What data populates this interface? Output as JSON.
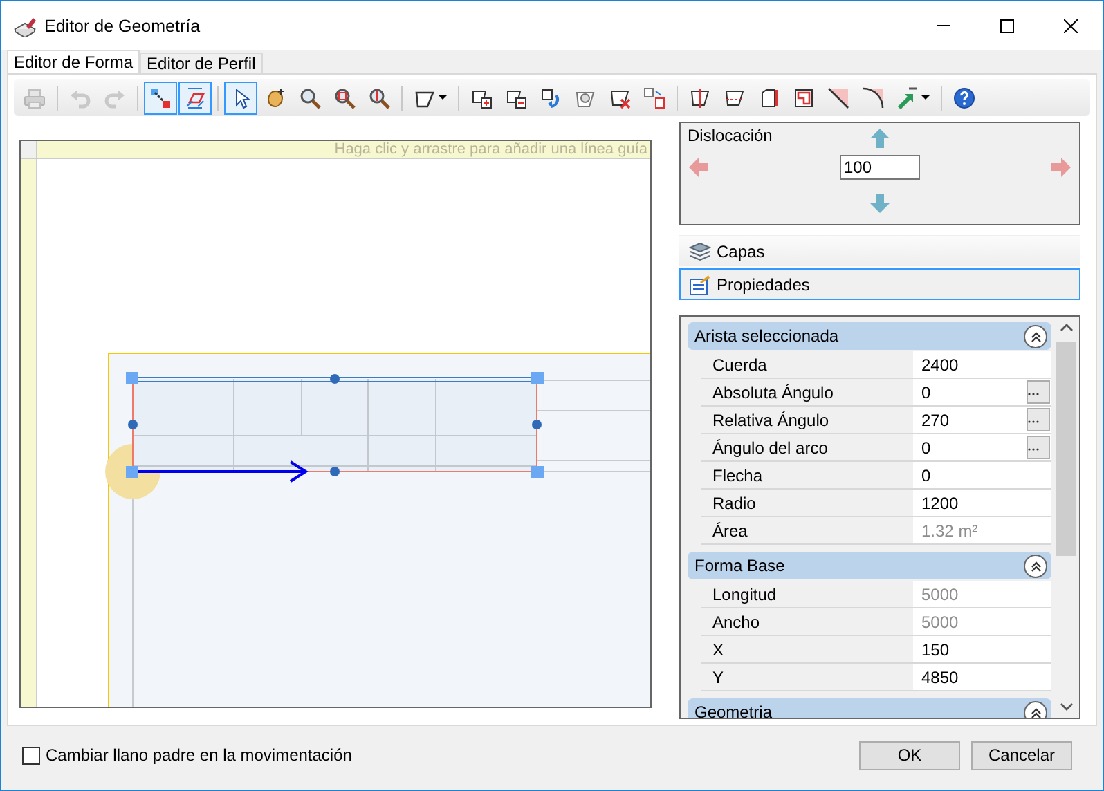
{
  "window": {
    "title": "Editor de Geometría"
  },
  "tabs": [
    {
      "label": "Editor de Forma",
      "selected": true
    },
    {
      "label": "Editor de Perfil",
      "selected": false
    }
  ],
  "toolbar": [
    {
      "kind": "button",
      "disabled": true,
      "selected": false
    },
    {
      "kind": "separator"
    },
    {
      "kind": "button",
      "disabled": true,
      "selected": false
    },
    {
      "kind": "button",
      "disabled": true,
      "selected": false
    },
    {
      "kind": "separator"
    },
    {
      "kind": "button",
      "disabled": false,
      "selected": true
    },
    {
      "kind": "button",
      "disabled": false,
      "selected": true
    },
    {
      "kind": "separator"
    },
    {
      "kind": "button",
      "disabled": false,
      "selected": true
    },
    {
      "kind": "button",
      "disabled": false,
      "selected": false
    },
    {
      "kind": "button",
      "disabled": false,
      "selected": false
    },
    {
      "kind": "button",
      "disabled": false,
      "selected": false
    },
    {
      "kind": "button",
      "disabled": false,
      "selected": false
    },
    {
      "kind": "separator"
    },
    {
      "kind": "dropdown",
      "disabled": false,
      "selected": false
    },
    {
      "kind": "separator"
    },
    {
      "kind": "button",
      "disabled": false,
      "selected": false
    },
    {
      "kind": "button",
      "disabled": false,
      "selected": false
    },
    {
      "kind": "button",
      "disabled": false,
      "selected": false
    },
    {
      "kind": "button",
      "disabled": false,
      "selected": false
    },
    {
      "kind": "button",
      "disabled": false,
      "selected": false
    },
    {
      "kind": "button",
      "disabled": false,
      "selected": false
    },
    {
      "kind": "separator"
    },
    {
      "kind": "button",
      "disabled": false,
      "selected": false
    },
    {
      "kind": "button",
      "disabled": false,
      "selected": false
    },
    {
      "kind": "button",
      "disabled": false,
      "selected": false
    },
    {
      "kind": "button",
      "disabled": false,
      "selected": false
    },
    {
      "kind": "button",
      "disabled": false,
      "selected": false
    },
    {
      "kind": "button",
      "disabled": false,
      "selected": false
    },
    {
      "kind": "dropdown",
      "disabled": false,
      "selected": false
    },
    {
      "kind": "separator"
    },
    {
      "kind": "button",
      "disabled": false,
      "selected": false
    }
  ],
  "canvas": {
    "guide_hint": "Haga clic y arrastre para añadir una línea guía"
  },
  "dislocation": {
    "title": "Dislocación",
    "value": "100"
  },
  "side_tabs": [
    {
      "label": "Capas",
      "selected": false
    },
    {
      "label": "Propiedades",
      "selected": true
    }
  ],
  "properties": [
    {
      "title": "Arista seleccionada",
      "expanded": true,
      "rows": [
        {
          "label": "Cuerda",
          "value": "2400",
          "readonly": false,
          "has_button": false
        },
        {
          "label": "Absoluta Ángulo",
          "value": "0",
          "readonly": false,
          "has_button": true
        },
        {
          "label": "Relativa Ángulo",
          "value": "270",
          "readonly": false,
          "has_button": true
        },
        {
          "label": "Ángulo del arco",
          "value": "0",
          "readonly": false,
          "has_button": true
        },
        {
          "label": "Flecha",
          "value": "0",
          "readonly": false,
          "has_button": false
        },
        {
          "label": "Radio",
          "value": "1200",
          "readonly": false,
          "has_button": false
        },
        {
          "label": "Área",
          "value": "1.32 m²",
          "readonly": true,
          "has_button": false
        }
      ]
    },
    {
      "title": "Forma Base",
      "expanded": true,
      "rows": [
        {
          "label": "Longitud",
          "value": "5000",
          "readonly": true,
          "has_button": false
        },
        {
          "label": "Ancho",
          "value": "5000",
          "readonly": true,
          "has_button": false
        },
        {
          "label": "X",
          "value": "150",
          "readonly": false,
          "has_button": false
        },
        {
          "label": "Y",
          "value": "4850",
          "readonly": false,
          "has_button": false
        }
      ]
    },
    {
      "title": "Geometria",
      "expanded": true
    }
  ],
  "footer": {
    "checkbox": {
      "label": "Cambiar llano padre en la movimentación",
      "checked": false
    },
    "buttons": [
      "OK",
      "Cancelar"
    ]
  }
}
